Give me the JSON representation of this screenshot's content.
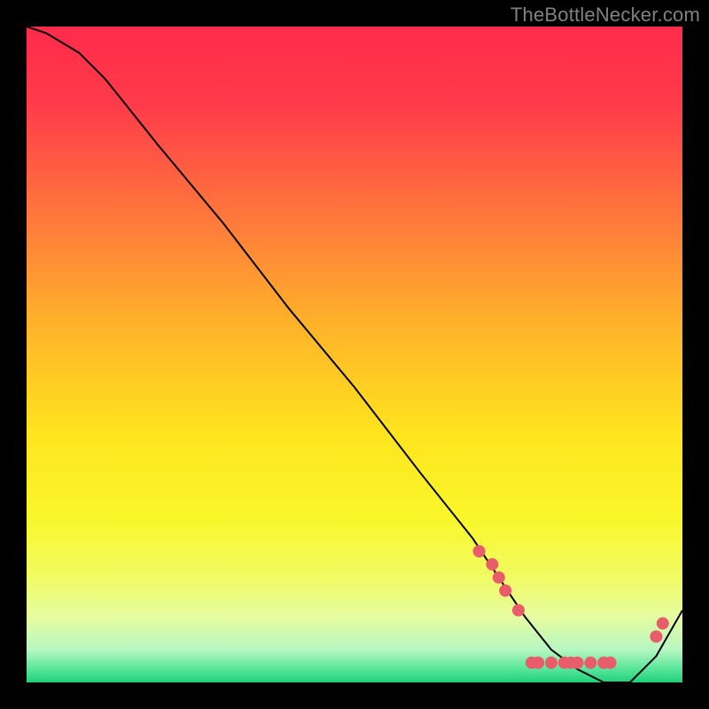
{
  "watermark": "TheBottleNecker.com",
  "chart_data": {
    "type": "line",
    "title": "",
    "xlabel": "",
    "ylabel": "",
    "xlim": [
      0,
      100
    ],
    "ylim": [
      0,
      100
    ],
    "grid": false,
    "series": [
      {
        "name": "curve",
        "x": [
          0,
          3,
          8,
          12,
          20,
          30,
          40,
          50,
          60,
          68,
          72,
          76,
          80,
          84,
          88,
          92,
          96,
          100
        ],
        "values": [
          100,
          99,
          96,
          92,
          82,
          70,
          57,
          45,
          32,
          22,
          16,
          10,
          5,
          2,
          0,
          0,
          4,
          11
        ]
      }
    ],
    "markers": [
      {
        "x": 69,
        "y": 20
      },
      {
        "x": 71,
        "y": 18
      },
      {
        "x": 72,
        "y": 16
      },
      {
        "x": 73,
        "y": 14
      },
      {
        "x": 75,
        "y": 11
      },
      {
        "x": 77,
        "y": 3
      },
      {
        "x": 78,
        "y": 3
      },
      {
        "x": 80,
        "y": 3
      },
      {
        "x": 82,
        "y": 3
      },
      {
        "x": 83,
        "y": 3
      },
      {
        "x": 84,
        "y": 3
      },
      {
        "x": 86,
        "y": 3
      },
      {
        "x": 88,
        "y": 3
      },
      {
        "x": 89,
        "y": 3
      },
      {
        "x": 96,
        "y": 7
      },
      {
        "x": 97,
        "y": 9
      }
    ],
    "gradient_stops": [
      {
        "offset": 0.0,
        "color": "#ff2b4b"
      },
      {
        "offset": 0.12,
        "color": "#ff3b4a"
      },
      {
        "offset": 0.3,
        "color": "#ff7b3b"
      },
      {
        "offset": 0.45,
        "color": "#ffb12a"
      },
      {
        "offset": 0.62,
        "color": "#ffe41e"
      },
      {
        "offset": 0.75,
        "color": "#f9f72a"
      },
      {
        "offset": 0.84,
        "color": "#f1fb63"
      },
      {
        "offset": 0.9,
        "color": "#e6fca0"
      },
      {
        "offset": 0.95,
        "color": "#b7f7c1"
      },
      {
        "offset": 0.98,
        "color": "#57e59a"
      },
      {
        "offset": 1.0,
        "color": "#1fd07a"
      }
    ],
    "marker_style": {
      "fill": "#e95d6a",
      "radius": 7
    },
    "line_style": {
      "stroke": "#000000",
      "width": 2
    }
  }
}
